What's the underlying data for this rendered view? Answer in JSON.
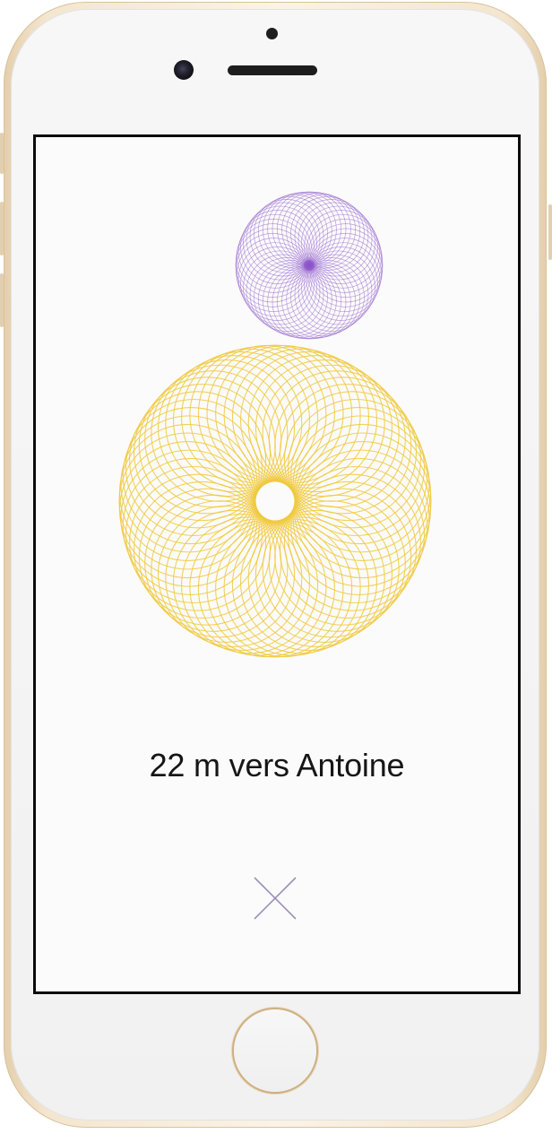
{
  "screen": {
    "distance_text": "22 m vers Antoine",
    "close_icon": "x-close-icon"
  },
  "rings": {
    "target_color": "#8a54c8",
    "self_color": "#f0c93e"
  },
  "device": {
    "frame_color": "#f0dfc2"
  }
}
